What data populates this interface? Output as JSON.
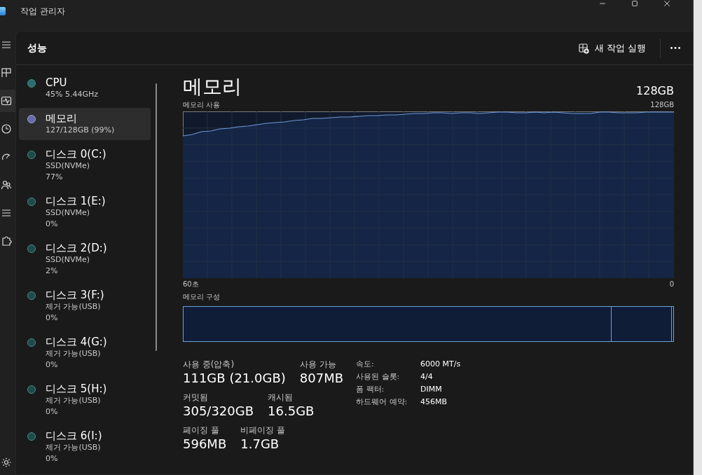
{
  "window": {
    "title": "작업 관리자"
  },
  "nav": [
    {
      "kind": "menu",
      "selected": false
    },
    {
      "kind": "processes",
      "selected": false
    },
    {
      "kind": "performance",
      "selected": true
    },
    {
      "kind": "history",
      "selected": false
    },
    {
      "kind": "startup",
      "selected": false
    },
    {
      "kind": "users",
      "selected": false
    },
    {
      "kind": "details",
      "selected": false
    },
    {
      "kind": "services",
      "selected": false
    }
  ],
  "nav_bottom": [
    {
      "kind": "settings",
      "selected": false
    }
  ],
  "page": {
    "title": "성능",
    "action": "새 작업 실행"
  },
  "devices": [
    {
      "name": "CPU",
      "details": [
        "45% 5.44GHz"
      ],
      "color": "#2e6b6e",
      "selected": false
    },
    {
      "name": "메모리",
      "details": [
        "127/128GB (99%)"
      ],
      "color": "#6a6aa8",
      "selected": true
    },
    {
      "name": "디스크 0(C:)",
      "details": [
        "SSD(NVMe)",
        "77%"
      ],
      "color": "#1f4a47",
      "selected": false
    },
    {
      "name": "디스크 1(E:)",
      "details": [
        "SSD(NVMe)",
        "0%"
      ],
      "color": "#1f4a47",
      "selected": false
    },
    {
      "name": "디스크 2(D:)",
      "details": [
        "SSD(NVMe)",
        "2%"
      ],
      "color": "#1f4a47",
      "selected": false
    },
    {
      "name": "디스크 3(F:)",
      "details": [
        "제거 가능(USB)",
        "0%"
      ],
      "color": "#1f4a47",
      "selected": false
    },
    {
      "name": "디스크 4(G:)",
      "details": [
        "제거 가능(USB)",
        "0%"
      ],
      "color": "#1f4a47",
      "selected": false
    },
    {
      "name": "디스크 5(H:)",
      "details": [
        "제거 가능(USB)",
        "0%"
      ],
      "color": "#1f4a47",
      "selected": false
    },
    {
      "name": "디스크 6(I:)",
      "details": [
        "제거 가능(USB)",
        "0%"
      ],
      "color": "#1f4a47",
      "selected": false
    }
  ],
  "memory": {
    "title": "메모리",
    "total": "128GB",
    "usage_label": "메모리 사용",
    "usage_max": "128GB",
    "time_start": "60초",
    "time_end": "0",
    "composition_label": "메모리 구성",
    "composition": [
      {
        "level": 0.874
      },
      {
        "level": 0.123
      },
      {
        "level": 0.003
      }
    ],
    "stats": [
      [
        {
          "label": "사용 중(압축)",
          "value": "111GB (21.0GB)"
        },
        {
          "label": "사용 가능",
          "value": "807MB"
        }
      ],
      [
        {
          "label": "커밋됨",
          "value": "305/320GB"
        },
        {
          "label": "캐시됨",
          "value": "16.5GB"
        }
      ],
      [
        {
          "label": "페이징 풀",
          "value": "596MB"
        },
        {
          "label": "비페이징 풀",
          "value": "1.7GB"
        }
      ]
    ],
    "specs": [
      {
        "label": "속도:",
        "value": "6000 MT/s"
      },
      {
        "label": "사용된 슬롯:",
        "value": "4/4"
      },
      {
        "label": "폼 팩터:",
        "value": "DIMM"
      },
      {
        "label": "하드웨어 예약:",
        "value": "456MB"
      }
    ]
  }
}
